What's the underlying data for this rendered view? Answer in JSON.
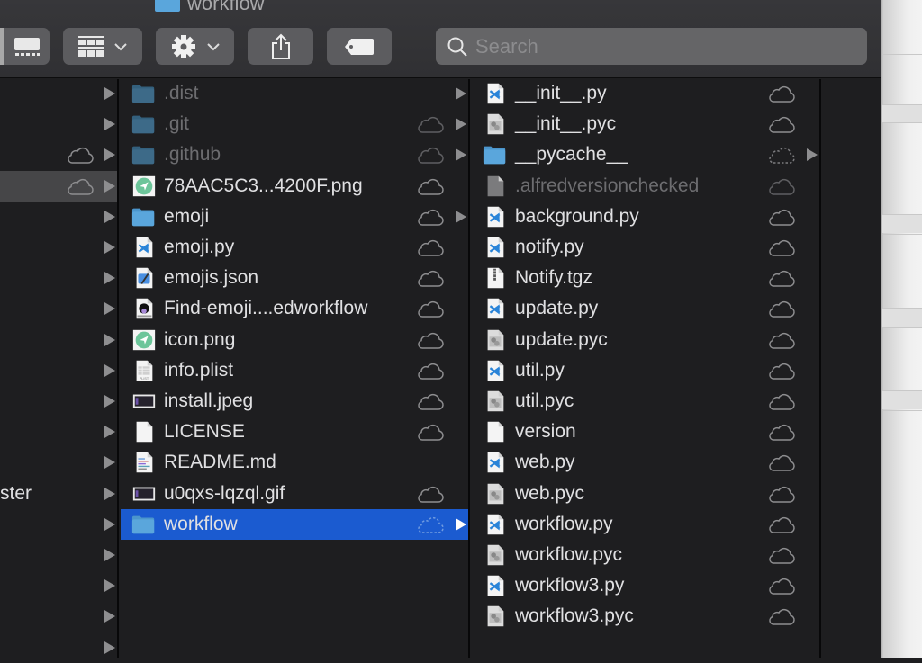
{
  "window": {
    "title": "workflow"
  },
  "toolbar": {
    "view_icon": "cover-flow-view-icon",
    "group_icon": "group-grid-icon",
    "action_icon": "gear-icon",
    "share_icon": "share-icon",
    "tag_icon": "tag-icon",
    "search_placeholder": "Search",
    "search_value": ""
  },
  "colors": {
    "selection_blue": "#1b5bd0",
    "selection_gray": "#464648",
    "folder_blue": "#5aa6dc",
    "vscode_blue": "#2a84d8"
  },
  "column1": {
    "items": [
      {
        "label": "",
        "cloud": "none",
        "arrow": true
      },
      {
        "label": "",
        "cloud": "none",
        "arrow": true
      },
      {
        "label": "",
        "cloud": "solid",
        "arrow": true
      },
      {
        "label": "",
        "cloud": "solid",
        "arrow": true,
        "selected": "gray"
      },
      {
        "label": "",
        "cloud": "none",
        "arrow": true
      },
      {
        "label": "",
        "cloud": "none",
        "arrow": true
      },
      {
        "label": "",
        "cloud": "none",
        "arrow": true
      },
      {
        "label": "",
        "cloud": "none",
        "arrow": true
      },
      {
        "label": "",
        "cloud": "none",
        "arrow": true
      },
      {
        "label": "",
        "cloud": "none",
        "arrow": true
      },
      {
        "label": "",
        "cloud": "none",
        "arrow": true
      },
      {
        "label": "",
        "cloud": "none",
        "arrow": true
      },
      {
        "label": "",
        "cloud": "none",
        "arrow": true
      },
      {
        "label": "ster",
        "cloud": "none",
        "arrow": true
      },
      {
        "label": "",
        "cloud": "none",
        "arrow": true
      },
      {
        "label": "",
        "cloud": "none",
        "arrow": true
      },
      {
        "label": "",
        "cloud": "none",
        "arrow": true
      },
      {
        "label": "",
        "cloud": "none",
        "arrow": true
      },
      {
        "label": "",
        "cloud": "none",
        "arrow": true
      }
    ]
  },
  "column2": {
    "items": [
      {
        "label": ".dist",
        "icon": "folder",
        "dim": true,
        "cloud": "none",
        "arrow": true
      },
      {
        "label": ".git",
        "icon": "folder",
        "dim": true,
        "cloud": "solid-dim",
        "arrow": true
      },
      {
        "label": ".github",
        "icon": "folder",
        "dim": true,
        "cloud": "solid-dim",
        "arrow": true
      },
      {
        "label": "78AAC5C3...4200F.png",
        "icon": "image-green",
        "cloud": "solid",
        "arrow": false
      },
      {
        "label": "emoji",
        "icon": "folder",
        "cloud": "solid",
        "arrow": true
      },
      {
        "label": "emoji.py",
        "icon": "vscode",
        "cloud": "solid",
        "arrow": false
      },
      {
        "label": "emojis.json",
        "icon": "xcode",
        "cloud": "solid",
        "arrow": false
      },
      {
        "label": "Find-emoji....edworkflow",
        "icon": "alfred-workflow",
        "cloud": "solid",
        "arrow": false
      },
      {
        "label": "icon.png",
        "icon": "image-green",
        "cloud": "solid",
        "arrow": false
      },
      {
        "label": "info.plist",
        "icon": "plist",
        "cloud": "solid",
        "arrow": false
      },
      {
        "label": "install.jpeg",
        "icon": "image-dark",
        "cloud": "solid",
        "arrow": false
      },
      {
        "label": "LICENSE",
        "icon": "blank",
        "cloud": "solid",
        "arrow": false
      },
      {
        "label": "README.md",
        "icon": "markdown",
        "cloud": "none",
        "arrow": false
      },
      {
        "label": "u0qxs-lqzql.gif",
        "icon": "image-dark",
        "cloud": "solid",
        "arrow": false
      },
      {
        "label": "workflow",
        "icon": "folder",
        "cloud": "dashed",
        "arrow": true,
        "selected": "blue"
      }
    ]
  },
  "column3": {
    "items": [
      {
        "label": "__init__.py",
        "icon": "vscode",
        "cloud": "solid",
        "arrow": false
      },
      {
        "label": "__init__.pyc",
        "icon": "pyc",
        "cloud": "solid",
        "arrow": false
      },
      {
        "label": "__pycache__",
        "icon": "folder",
        "cloud": "dashed",
        "arrow": true
      },
      {
        "label": ".alfredversionchecked",
        "icon": "blank-gray",
        "dim": true,
        "cloud": "solid-dim",
        "arrow": false
      },
      {
        "label": "background.py",
        "icon": "vscode",
        "cloud": "solid",
        "arrow": false
      },
      {
        "label": "notify.py",
        "icon": "vscode",
        "cloud": "solid",
        "arrow": false
      },
      {
        "label": "Notify.tgz",
        "icon": "archive",
        "cloud": "solid",
        "arrow": false
      },
      {
        "label": "update.py",
        "icon": "vscode",
        "cloud": "solid",
        "arrow": false
      },
      {
        "label": "update.pyc",
        "icon": "pyc",
        "cloud": "solid",
        "arrow": false
      },
      {
        "label": "util.py",
        "icon": "vscode",
        "cloud": "solid",
        "arrow": false
      },
      {
        "label": "util.pyc",
        "icon": "pyc",
        "cloud": "solid",
        "arrow": false
      },
      {
        "label": "version",
        "icon": "blank",
        "cloud": "solid",
        "arrow": false
      },
      {
        "label": "web.py",
        "icon": "vscode",
        "cloud": "solid",
        "arrow": false
      },
      {
        "label": "web.pyc",
        "icon": "pyc",
        "cloud": "solid",
        "arrow": false
      },
      {
        "label": "workflow.py",
        "icon": "vscode",
        "cloud": "solid",
        "arrow": false
      },
      {
        "label": "workflow.pyc",
        "icon": "pyc",
        "cloud": "solid",
        "arrow": false
      },
      {
        "label": "workflow3.py",
        "icon": "vscode",
        "cloud": "solid",
        "arrow": false
      },
      {
        "label": "workflow3.pyc",
        "icon": "pyc",
        "cloud": "solid",
        "arrow": false
      }
    ]
  }
}
